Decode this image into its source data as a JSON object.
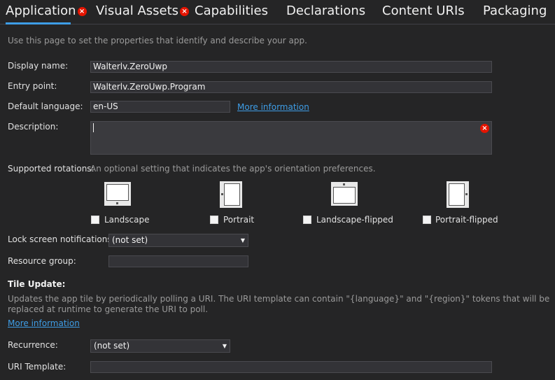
{
  "tabs": [
    {
      "label": "Application",
      "active": true,
      "error": true
    },
    {
      "label": "Visual Assets",
      "active": false,
      "error": true
    },
    {
      "label": "Capabilities",
      "active": false,
      "error": false
    },
    {
      "label": "Declarations",
      "active": false,
      "error": false
    },
    {
      "label": "Content URIs",
      "active": false,
      "error": false
    },
    {
      "label": "Packaging",
      "active": false,
      "error": false
    }
  ],
  "intro": "Use this page to set the properties that identify and describe your app.",
  "fields": {
    "display_name": {
      "label": "Display name:",
      "value": "Walterlv.ZeroUwp"
    },
    "entry_point": {
      "label": "Entry point:",
      "value": "Walterlv.ZeroUwp.Program"
    },
    "default_language": {
      "label": "Default language:",
      "value": "en-US",
      "link": "More information"
    },
    "description": {
      "label": "Description:",
      "value": ""
    }
  },
  "rotations": {
    "label": "Supported rotations:",
    "hint": "An optional setting that indicates the app's orientation preferences.",
    "options": [
      {
        "label": "Landscape",
        "checked": false
      },
      {
        "label": "Portrait",
        "checked": false
      },
      {
        "label": "Landscape-flipped",
        "checked": false
      },
      {
        "label": "Portrait-flipped",
        "checked": false
      }
    ]
  },
  "lock_screen": {
    "label": "Lock screen notifications:",
    "value": "(not set)"
  },
  "resource_group": {
    "label": "Resource group:",
    "value": ""
  },
  "tile_update": {
    "heading": "Tile Update:",
    "desc_line1": "Updates the app tile by periodically polling a URI. The URI template can contain \"{language}\" and \"{region}\" tokens that will be",
    "desc_line2": "replaced at runtime to generate the URI to poll.",
    "link": "More information",
    "recurrence": {
      "label": "Recurrence:",
      "value": "(not set)"
    },
    "uri_template": {
      "label": "URI Template:",
      "value": ""
    }
  },
  "colors": {
    "background": "#252526",
    "accent": "#3e9de6",
    "error": "#e51400"
  }
}
